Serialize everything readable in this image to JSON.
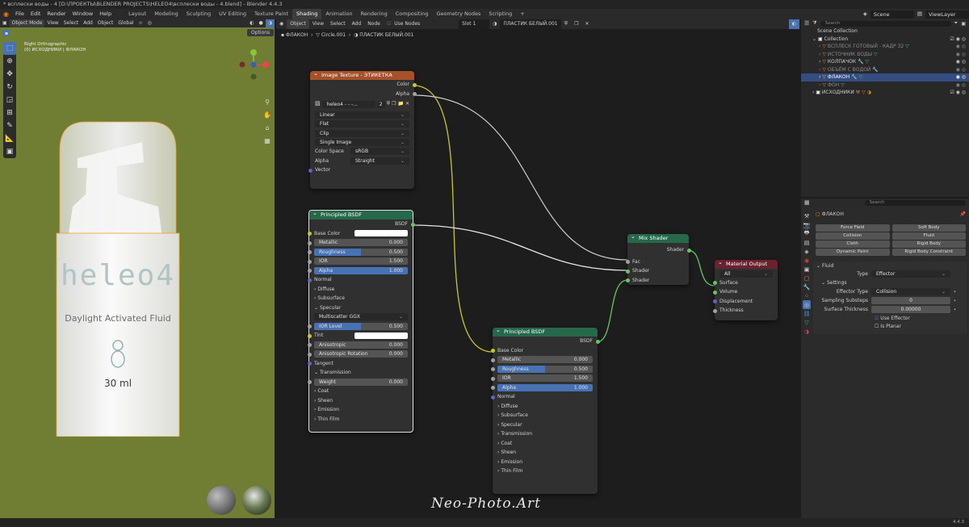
{
  "window_title": "* всплески воды - 4 [D:\\ПРОЕКТЫ\\BLENDER PROJECTS\\HELEO4\\всплески воды - 4.blend] - Blender 4.4.3",
  "menu": [
    "File",
    "Edit",
    "Render",
    "Window",
    "Help"
  ],
  "workspaces": [
    "Layout",
    "Modeling",
    "Sculpting",
    "UV Editing",
    "Texture Paint",
    "Shading",
    "Animation",
    "Rendering",
    "Compositing",
    "Geometry Nodes",
    "Scripting"
  ],
  "active_workspace": "Shading",
  "scene": "Scene",
  "view_layer": "ViewLayer",
  "viewport": {
    "mode": "Object Mode",
    "menu": [
      "View",
      "Select",
      "Add",
      "Object"
    ],
    "orientation": "Global",
    "options": "Options",
    "view_name": "Right Orthographic",
    "view_sub": "(0) ИСХОДНИКИ | ФЛАКОН",
    "label_brand": "heleo4",
    "label_line": "Daylight Activated Fluid",
    "label_volume": "30 ml"
  },
  "node_editor": {
    "type": "Object",
    "menu": [
      "View",
      "Select",
      "Add",
      "Node"
    ],
    "slot": "Slot 1",
    "material": "ПЛАСТИК БЕЛЫЙ.001",
    "use_nodes": "Use Nodes",
    "breadcrumb": [
      "ФЛАКОН",
      "Circle.001",
      "ПЛАСТИК БЕЛЫЙ.001"
    ],
    "watermark": "Neo-Photo.Art"
  },
  "image_texture": {
    "title": "Image Texture - ЭТИКЕТКА",
    "out_color": "Color",
    "out_alpha": "Alpha",
    "image": "heleo4 - - -...",
    "users": "2",
    "interp": "Linear",
    "projection": "Flat",
    "extension": "Clip",
    "source": "Single Image",
    "colorspace_label": "Color Space",
    "colorspace": "sRGB",
    "alpha_label": "Alpha",
    "alpha": "Straight",
    "in_vector": "Vector"
  },
  "bsdf1": {
    "title": "Principled BSDF",
    "out": "BSDF",
    "base_color": "Base Color",
    "metallic": "Metallic",
    "metallic_v": "0.000",
    "roughness": "Roughness",
    "roughness_v": "0.500",
    "ior": "IOR",
    "ior_v": "1.500",
    "alpha": "Alpha",
    "alpha_v": "1.000",
    "normal": "Normal",
    "diffuse": "Diffuse",
    "subsurface": "Subsurface",
    "specular": "Specular",
    "dist": "Multiscatter GGX",
    "ior_level": "IOR Level",
    "ior_level_v": "0.500",
    "tint": "Tint",
    "aniso": "Anisotropic",
    "aniso_v": "0.000",
    "aniso_rot": "Anisotropic Rotation",
    "aniso_rot_v": "0.000",
    "tangent": "Tangent",
    "transmission": "Transmission",
    "weight": "Weight",
    "weight_v": "0.000",
    "coat": "Coat",
    "sheen": "Sheen",
    "emission": "Emission",
    "thin_film": "Thin Film"
  },
  "bsdf2": {
    "title": "Principled BSDF",
    "out": "BSDF",
    "base_color": "Base Color",
    "metallic": "Metallic",
    "metallic_v": "0.000",
    "roughness": "Roughness",
    "roughness_v": "0.500",
    "ior": "IOR",
    "ior_v": "1.500",
    "alpha": "Alpha",
    "alpha_v": "1.000",
    "normal": "Normal",
    "diffuse": "Diffuse",
    "subsurface": "Subsurface",
    "specular": "Specular",
    "transmission": "Transmission",
    "coat": "Coat",
    "sheen": "Sheen",
    "emission": "Emission",
    "thin_film": "Thin Film"
  },
  "mix_shader": {
    "title": "Mix Shader",
    "out": "Shader",
    "fac": "Fac",
    "shader_a": "Shader",
    "shader_b": "Shader"
  },
  "material_output": {
    "title": "Material Output",
    "target": "All",
    "surface": "Surface",
    "volume": "Volume",
    "displacement": "Displacement",
    "thickness": "Thickness"
  },
  "outliner": {
    "search": "Search",
    "scene_collection": "Scene Collection",
    "items": [
      {
        "label": "Collection",
        "indent": 1
      },
      {
        "label": "ВСПЛЕСК ГОТОВЫЙ - КАДР 32",
        "indent": 2
      },
      {
        "label": "ИСТОЧНИК ВОДЫ",
        "indent": 2
      },
      {
        "label": "КОЛПАЧОК",
        "indent": 2
      },
      {
        "label": "ОБЪЁМ С ВОДОЙ",
        "indent": 2
      },
      {
        "label": "ФЛАКОН",
        "indent": 2
      },
      {
        "label": "ФОН",
        "indent": 2
      },
      {
        "label": "ИСХОДНИКИ",
        "indent": 1
      }
    ]
  },
  "properties": {
    "search": "Search",
    "object": "ФЛАКОН",
    "physics": [
      "Force Field",
      "Soft Body",
      "Collision",
      "Fluid",
      "Cloth",
      "Rigid Body",
      "Dynamic Paint",
      "Rigid Body Constraint"
    ],
    "panel": "Fluid",
    "type_label": "Type",
    "type": "Effector",
    "settings": "Settings",
    "effector_type_label": "Effector Type",
    "effector_type": "Collision",
    "substeps_label": "Sampling Substeps",
    "substeps": "0",
    "thickness_label": "Surface Thickness",
    "thickness": "0.00000",
    "use_effector": "Use Effector",
    "is_planar": "Is Planar"
  },
  "version": "4.4.3"
}
